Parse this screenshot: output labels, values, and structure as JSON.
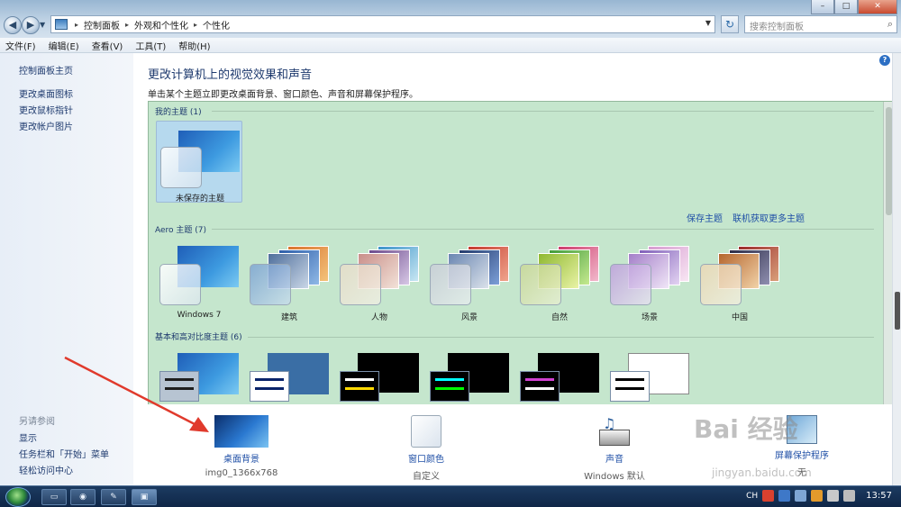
{
  "address": {
    "crumbs": [
      "控制面板",
      "外观和个性化",
      "个性化"
    ],
    "search_placeholder": "搜索控制面板"
  },
  "menu": [
    "文件(F)",
    "编辑(E)",
    "查看(V)",
    "工具(T)",
    "帮助(H)"
  ],
  "left": {
    "links": [
      "控制面板主页",
      "更改桌面图标",
      "更改鼠标指针",
      "更改帐户图片"
    ],
    "see_also_title": "另请参阅",
    "see_also": [
      "显示",
      "任务栏和「开始」菜单",
      "轻松访问中心"
    ]
  },
  "main": {
    "title": "更改计算机上的视觉效果和声音",
    "subtitle": "单击某个主题立即更改桌面背景、窗口颜色、声音和屏幕保护程序。",
    "my_themes_label": "我的主题 (1)",
    "unsaved_theme": "未保存的主题",
    "save_theme": "保存主题",
    "get_more": "联机获取更多主题",
    "aero_label": "Aero 主题 (7)",
    "aero_themes": [
      "Windows 7",
      "建筑",
      "人物",
      "风景",
      "自然",
      "场景",
      "中国"
    ],
    "basic_label": "基本和高对比度主题 (6)"
  },
  "bottom": {
    "background": {
      "name": "桌面背景",
      "sub": "img0_1366x768"
    },
    "color": {
      "name": "窗口颜色",
      "sub": "自定义"
    },
    "sound": {
      "name": "声音",
      "sub": "Windows 默认"
    },
    "screensaver": {
      "name": "屏幕保护程序",
      "sub": "无"
    }
  },
  "watermark": {
    "main": "Bai 经验",
    "sub": "jingyan.baidu.com"
  },
  "taskbar": {
    "lang": "CH",
    "time": "13:57"
  },
  "colors": {
    "accent_link": "#1f4fa6",
    "theme_bg": "#c5e6cd",
    "arrow": "#e03a2c"
  }
}
